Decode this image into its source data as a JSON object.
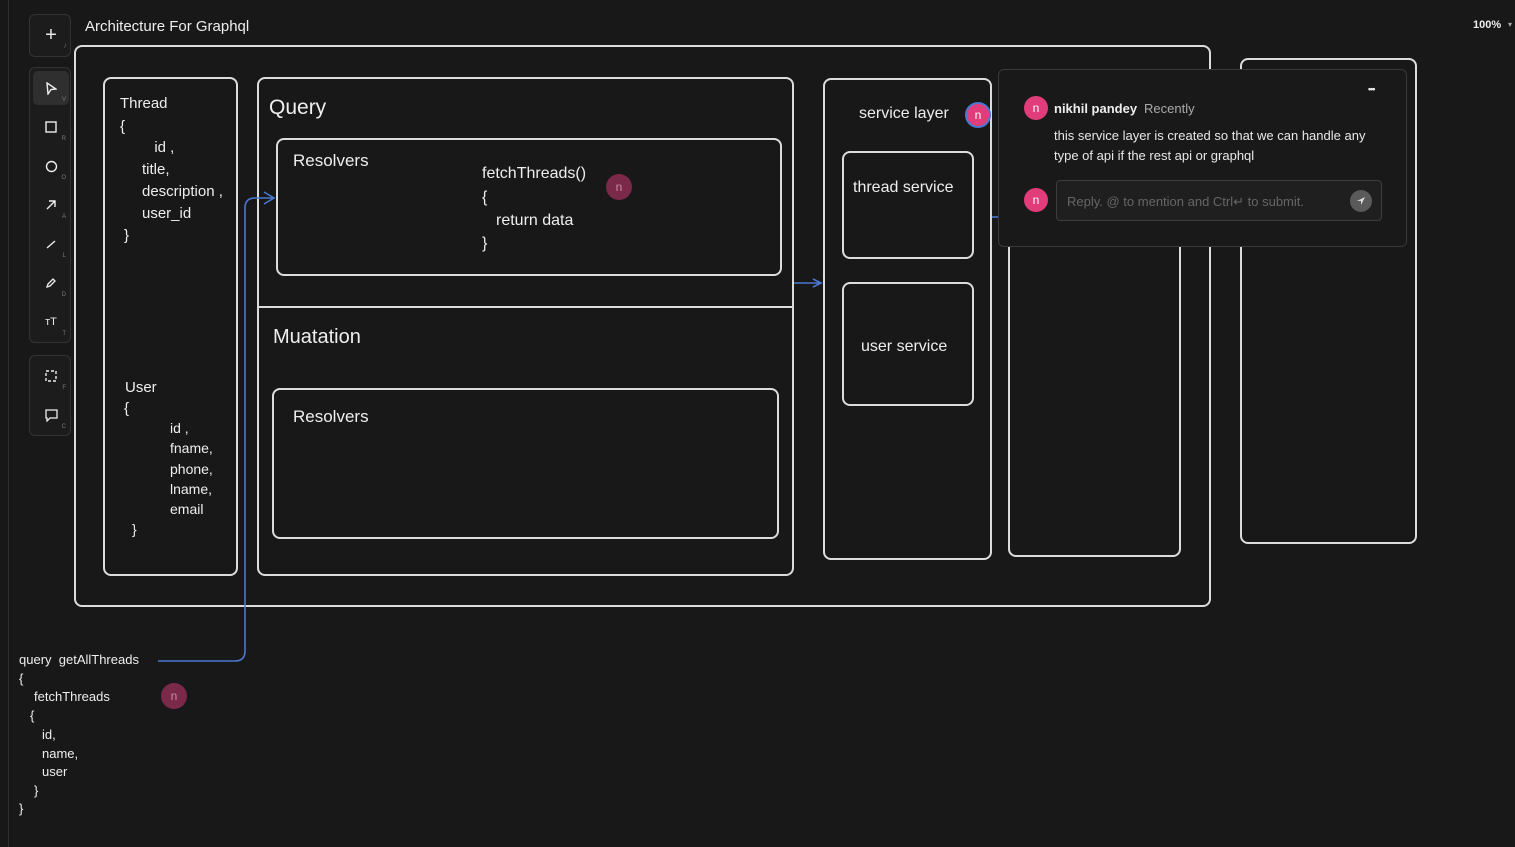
{
  "canvas": {
    "title": "Architecture For Graphql",
    "zoom": "100%"
  },
  "toolbar": {
    "add": {
      "icon": "plus-icon",
      "key": "/"
    },
    "tools": [
      {
        "name": "select",
        "icon": "cursor-icon",
        "key": "V"
      },
      {
        "name": "rectangle",
        "icon": "square-icon",
        "key": "R"
      },
      {
        "name": "ellipse",
        "icon": "circle-icon",
        "key": "O"
      },
      {
        "name": "arrow",
        "icon": "arrow-icon",
        "key": "A"
      },
      {
        "name": "line",
        "icon": "line-icon",
        "key": "L"
      },
      {
        "name": "draw",
        "icon": "pencil-icon",
        "key": "D"
      },
      {
        "name": "text",
        "icon": "text-icon",
        "key": "T"
      }
    ],
    "extra": [
      {
        "name": "frame",
        "icon": "frame-icon",
        "key": "F"
      },
      {
        "name": "comment",
        "icon": "comment-icon",
        "key": "C"
      }
    ]
  },
  "diagram": {
    "thread_schema": [
      "Thread",
      "{",
      "  id ,",
      "title,",
      "description ,",
      "user_id",
      "}"
    ],
    "user_schema": [
      "User",
      "{",
      "id ,",
      "fname,",
      "phone,",
      "lname,",
      "email",
      "}"
    ],
    "query_title": "Query",
    "query_resolvers": "Resolvers",
    "fetch_code": [
      "fetchThreads()",
      "{",
      "return data",
      "}"
    ],
    "mutation_title": "Muatation",
    "mutation_resolvers": "Resolvers",
    "service_layer": "service layer",
    "thread_service": "thread service",
    "user_service": "user service",
    "query_code": [
      "query  getAllThreads",
      "{",
      "fetchThreads",
      "{",
      "id,",
      "name,",
      "user",
      "}",
      "}"
    ]
  },
  "comment": {
    "avatar_letter": "n",
    "author": "nikhil pandey",
    "time": "Recently",
    "text": "this service layer is created so that we can handle any type of api if the rest api or graphql",
    "reply_placeholder": "Reply. @ to mention and Ctrl↵ to submit.",
    "more": "•••"
  },
  "colors": {
    "accent": "#e23d7b",
    "arrow": "#4a78d0"
  }
}
